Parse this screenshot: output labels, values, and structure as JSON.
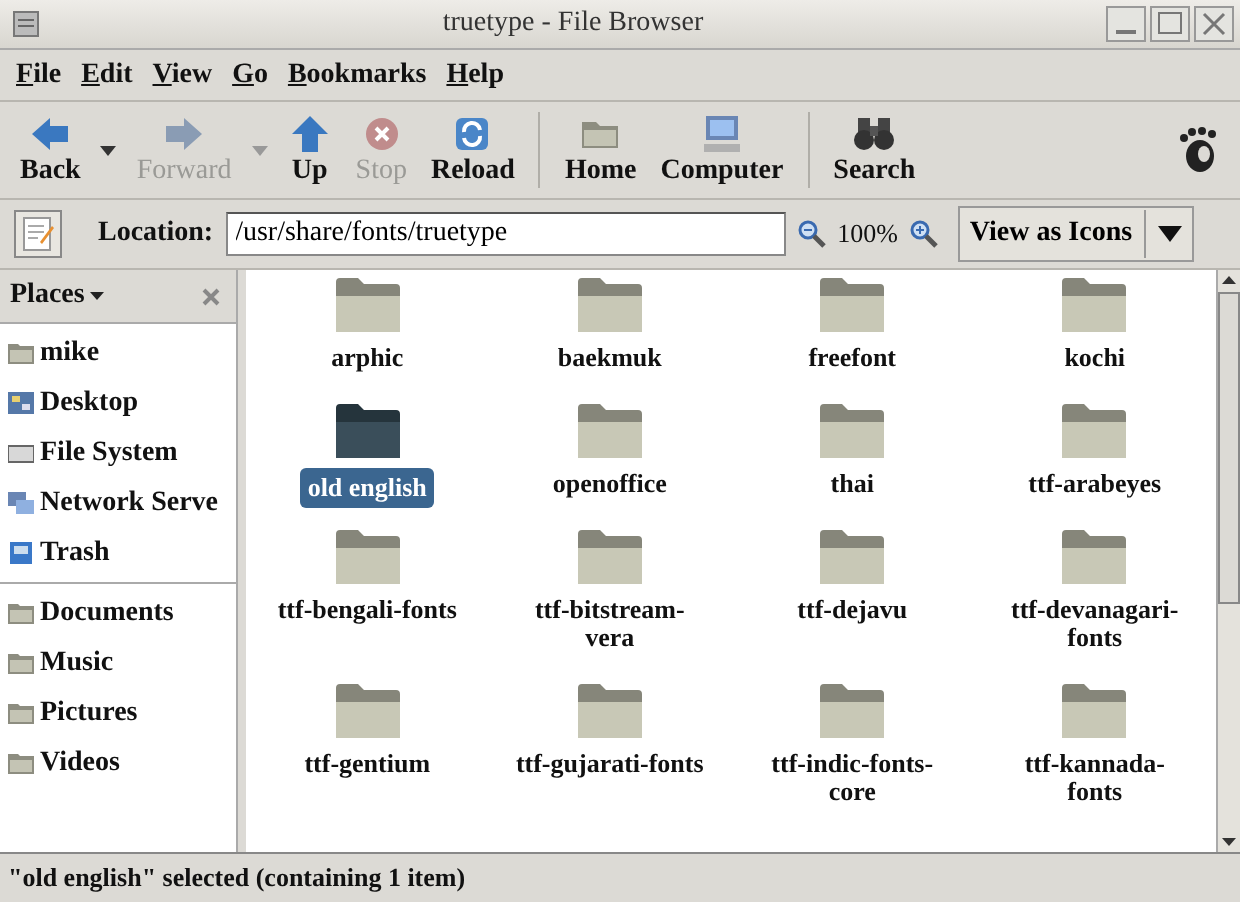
{
  "window": {
    "title": "truetype - File Browser"
  },
  "menu": [
    "File",
    "Edit",
    "View",
    "Go",
    "Bookmarks",
    "Help"
  ],
  "toolbar": {
    "groups": [
      [
        {
          "label": "Back",
          "kind": "back",
          "disabled": false,
          "dropdown": true
        },
        {
          "label": "Forward",
          "kind": "forward",
          "disabled": true,
          "dropdown": true
        },
        {
          "label": "Up",
          "kind": "up",
          "disabled": false,
          "dropdown": false
        },
        {
          "label": "Stop",
          "kind": "stop",
          "disabled": true,
          "dropdown": false
        },
        {
          "label": "Reload",
          "kind": "reload",
          "disabled": false,
          "dropdown": false
        }
      ],
      [
        {
          "label": "Home",
          "kind": "home",
          "disabled": false,
          "dropdown": false
        },
        {
          "label": "Computer",
          "kind": "computer",
          "disabled": false,
          "dropdown": false
        }
      ],
      [
        {
          "label": "Search",
          "kind": "search",
          "disabled": false,
          "dropdown": false
        }
      ]
    ]
  },
  "location": {
    "label": "Location:",
    "value": "/usr/share/fonts/truetype",
    "zoom": "100%",
    "view": "View as Icons"
  },
  "sidebar": {
    "title": "Places",
    "places": [
      {
        "label": "mike",
        "kind": "folder"
      },
      {
        "label": "Desktop",
        "kind": "desktop"
      },
      {
        "label": "File System",
        "kind": "drive"
      },
      {
        "label": "Network Serve",
        "kind": "network"
      },
      {
        "label": "Trash",
        "kind": "trash"
      }
    ],
    "bookmarks": [
      {
        "label": "Documents",
        "kind": "folder"
      },
      {
        "label": "Music",
        "kind": "folder"
      },
      {
        "label": "Pictures",
        "kind": "folder"
      },
      {
        "label": "Videos",
        "kind": "folder"
      }
    ]
  },
  "files": [
    {
      "name": "arphic",
      "selected": false
    },
    {
      "name": "baekmuk",
      "selected": false
    },
    {
      "name": "freefont",
      "selected": false
    },
    {
      "name": "kochi",
      "selected": false
    },
    {
      "name": "old english",
      "selected": true
    },
    {
      "name": "openoffice",
      "selected": false
    },
    {
      "name": "thai",
      "selected": false
    },
    {
      "name": "ttf-arabeyes",
      "selected": false
    },
    {
      "name": "ttf-bengali-fonts",
      "selected": false
    },
    {
      "name": "ttf-bitstream-vera",
      "selected": false
    },
    {
      "name": "ttf-dejavu",
      "selected": false
    },
    {
      "name": "ttf-devanagari-fonts",
      "selected": false
    },
    {
      "name": "ttf-gentium",
      "selected": false
    },
    {
      "name": "ttf-gujarati-fonts",
      "selected": false
    },
    {
      "name": "ttf-indic-fonts-core",
      "selected": false
    },
    {
      "name": "ttf-kannada-fonts",
      "selected": false
    }
  ],
  "status_bar": "\"old english\" selected (containing 1 item)"
}
